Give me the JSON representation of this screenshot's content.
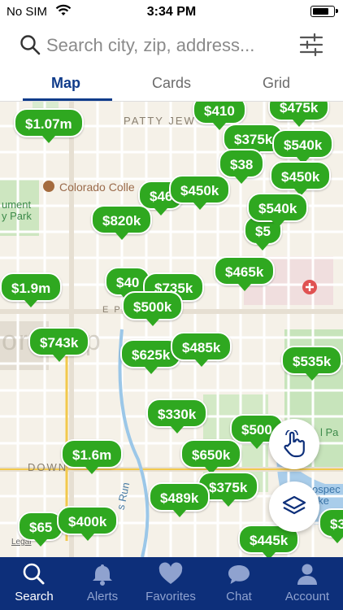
{
  "status_bar": {
    "carrier": "No SIM",
    "time": "3:34 PM"
  },
  "search": {
    "placeholder": "Search city, zip, address..."
  },
  "tabs": [
    {
      "label": "Map",
      "active": true
    },
    {
      "label": "Cards",
      "active": false
    },
    {
      "label": "Grid",
      "active": false
    }
  ],
  "map": {
    "labels": {
      "street_patty": "PATTY JEW",
      "street_pl": "E PL",
      "street_down": "DOWN",
      "college": "Colorado Colle",
      "park_left": "ument\ny Park",
      "watermark": "ora  Sp",
      "run": "s Run",
      "park_right": "l Pa",
      "lake": "ospec\nake",
      "legal": "Legal"
    },
    "prices": [
      "$1.07m",
      "$410",
      "$475k",
      "$375k",
      "$540k",
      "$38",
      "$450k",
      "$46",
      "$450k",
      "$820k",
      "$540k",
      "$5",
      "$465k",
      "$1.9m",
      "$40",
      "$735k",
      "$500k",
      "$743k",
      "$625k",
      "$485k",
      "$535k",
      "$330k",
      "$500",
      "$1.6m",
      "$650k",
      "$375k",
      "$489k",
      "$400k",
      "$65",
      "$445k",
      "$3"
    ]
  },
  "bottom_nav": [
    {
      "label": "Search",
      "icon": "search-icon",
      "active": true
    },
    {
      "label": "Alerts",
      "icon": "bell-icon",
      "active": false
    },
    {
      "label": "Favorites",
      "icon": "heart-icon",
      "active": false
    },
    {
      "label": "Chat",
      "icon": "chat-icon",
      "active": false
    },
    {
      "label": "Account",
      "icon": "account-icon",
      "active": false
    }
  ],
  "colors": {
    "accent": "#0f3b8a",
    "pin_green": "#2fa820",
    "nav_bg": "#0d2f7a"
  },
  "battery_level": 0.85
}
